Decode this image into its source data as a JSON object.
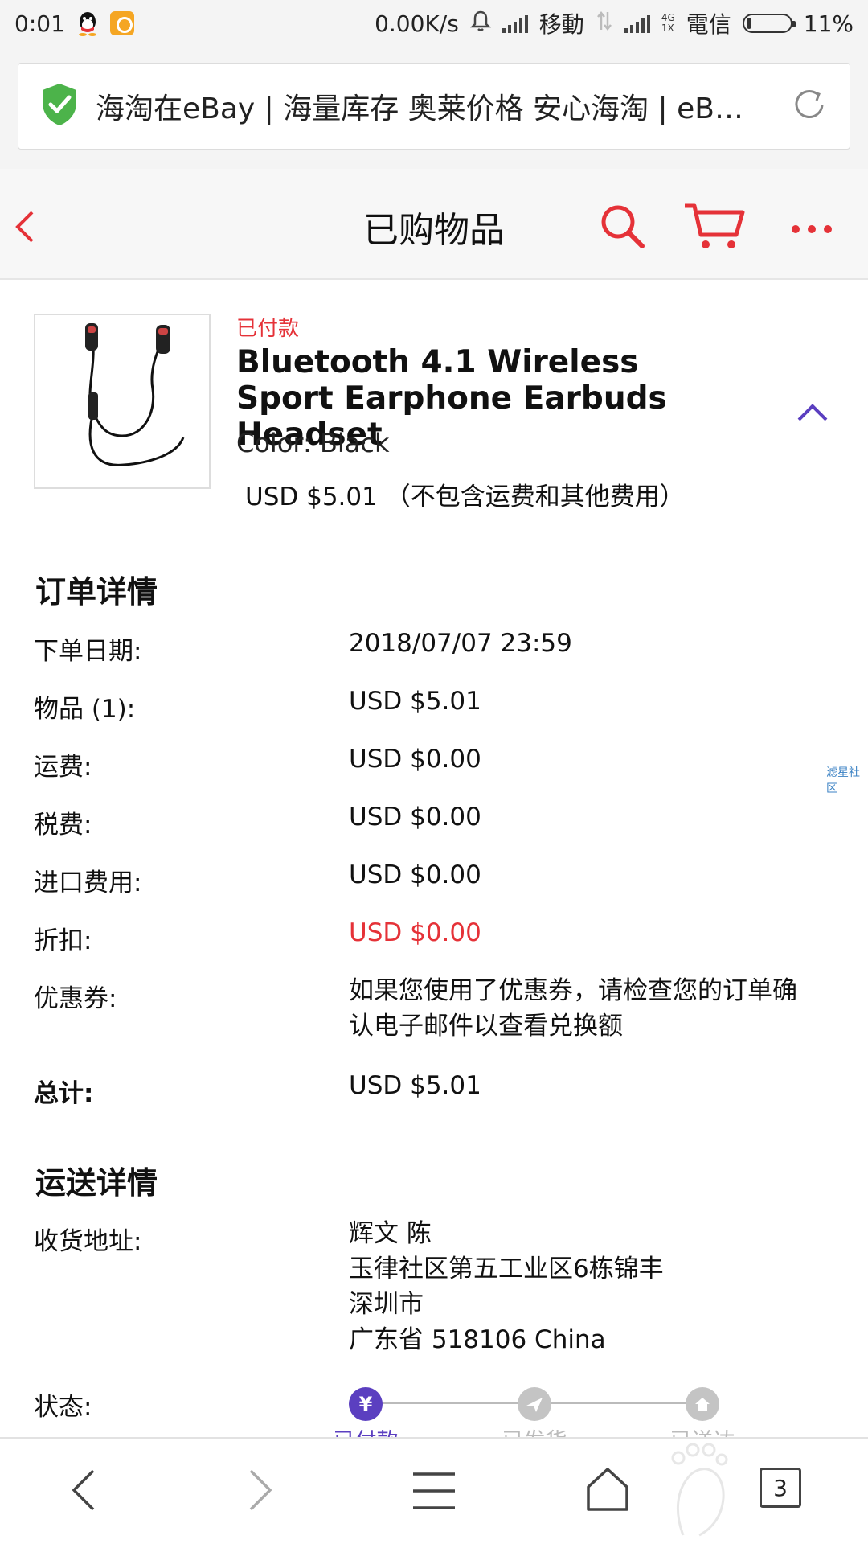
{
  "status_bar": {
    "time": "0:01",
    "net_speed": "0.00K/s",
    "carrier1": "移動",
    "carrier2": "電信",
    "net_type": "4G",
    "net_sub": "1X",
    "battery": "11%"
  },
  "browser": {
    "page_title": "海淘在eBay | 海量库存 奥莱价格 安心海淘 | eBa..."
  },
  "header": {
    "title": "已购物品"
  },
  "product": {
    "status": "已付款",
    "title": "Bluetooth 4.1 Wireless Sport Earphone Earbuds Headset",
    "color": "Color: Black",
    "price": "USD $5.01 （不包含运费和其他费用）"
  },
  "order_details": {
    "title": "订单详情",
    "rows": [
      {
        "label": "下单日期:",
        "value": "2018/07/07 23:59"
      },
      {
        "label": "物品 (1):",
        "value": "USD $5.01"
      },
      {
        "label": "运费:",
        "value": "USD $0.00"
      },
      {
        "label": "税费:",
        "value": "USD $0.00"
      },
      {
        "label": "进口费用:",
        "value": "USD $0.00"
      },
      {
        "label": "折扣:",
        "value": "USD $0.00"
      },
      {
        "label": "优惠券:",
        "value": "如果您使用了优惠券，请检查您的订单确认电子邮件以查看兑换额"
      },
      {
        "label": "总计:",
        "value": "USD $5.01"
      }
    ]
  },
  "shipping": {
    "title": "运送详情",
    "address_label": "收货地址:",
    "address_lines": [
      "辉文 陈",
      "玉律社区第五工业区6栋锦丰",
      "深圳市",
      "广东省 518106 China"
    ],
    "status_label": "状态:",
    "steps": [
      {
        "label": "已付款",
        "icon": "yen-icon",
        "active": true
      },
      {
        "label": "已发货",
        "icon": "plane-icon",
        "active": false
      },
      {
        "label": "已送达",
        "icon": "home-icon",
        "active": false
      }
    ]
  },
  "watermark": "滤星社区",
  "bottom_nav": {
    "tab_count": "3"
  },
  "colors": {
    "accent_red": "#e53238",
    "progress_active": "#5b3fc0",
    "progress_inactive": "#c4c4c4"
  }
}
